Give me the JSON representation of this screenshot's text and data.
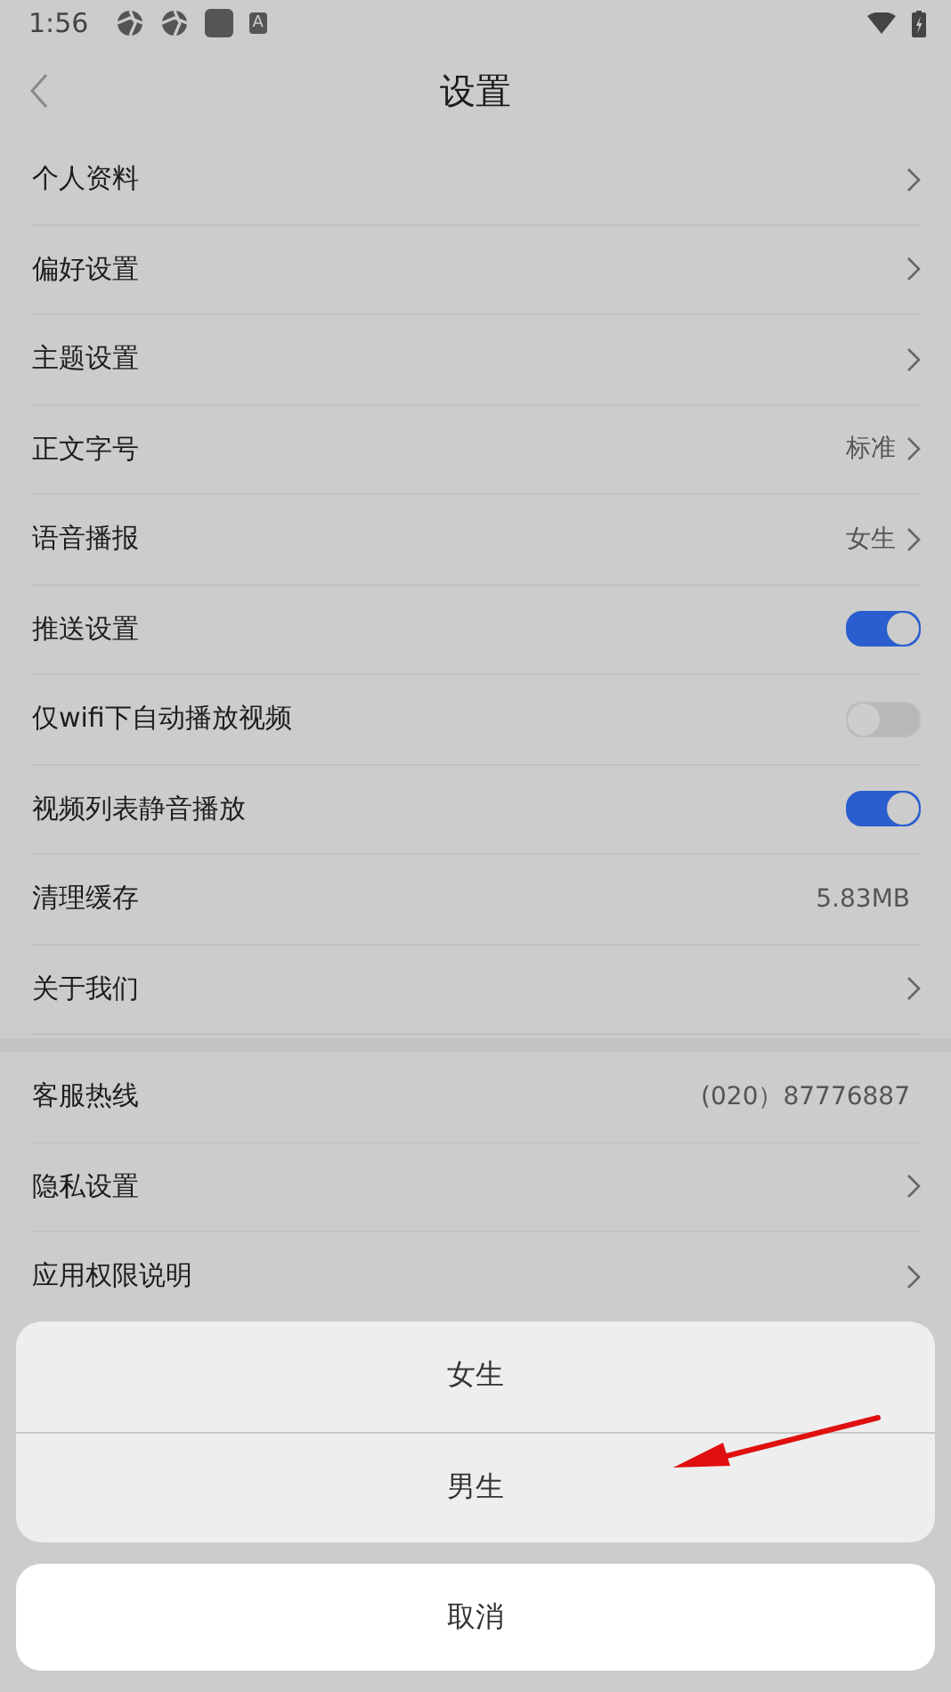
{
  "status_bar": {
    "time": "1:56",
    "badge_letter": "A"
  },
  "header": {
    "title": "设置"
  },
  "sections": [
    {
      "rows": [
        {
          "label": "个人资料",
          "kind": "link"
        },
        {
          "label": "偏好设置",
          "kind": "link"
        },
        {
          "label": "主题设置",
          "kind": "link"
        },
        {
          "label": "正文字号",
          "kind": "link",
          "value": "标准"
        },
        {
          "label": "语音播报",
          "kind": "link",
          "value": "女生"
        },
        {
          "label": "推送设置",
          "kind": "toggle",
          "on": true
        },
        {
          "label": "仅wifi下自动播放视频",
          "kind": "toggle",
          "on": false
        },
        {
          "label": "视频列表静音播放",
          "kind": "toggle",
          "on": true
        },
        {
          "label": "清理缓存",
          "kind": "value",
          "value": "5.83MB"
        },
        {
          "label": "关于我们",
          "kind": "link"
        }
      ]
    },
    {
      "rows": [
        {
          "label": "客服热线",
          "kind": "value",
          "value": "(020）87776887"
        },
        {
          "label": "隐私设置",
          "kind": "link"
        },
        {
          "label": "应用权限说明",
          "kind": "link"
        },
        {
          "kind": "hidden"
        },
        {
          "kind": "hidden"
        }
      ]
    }
  ],
  "action_sheet": {
    "options": [
      {
        "label": "女生"
      },
      {
        "label": "男生"
      }
    ],
    "cancel": "取消"
  }
}
